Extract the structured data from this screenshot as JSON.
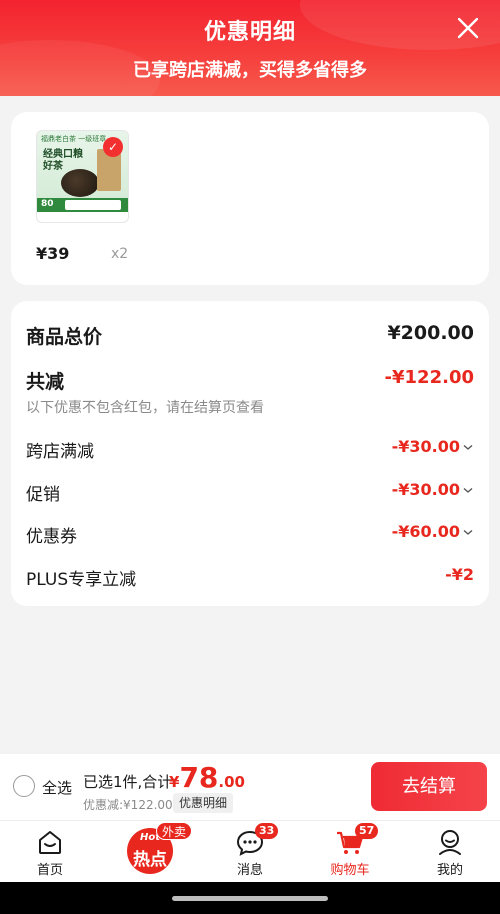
{
  "header": {
    "title": "优惠明细",
    "subtitle": "已享跨店满减，买得多省得多",
    "close_icon": "close-icon"
  },
  "product": {
    "image_brand": "福鼎老白茶 一级班章",
    "image_text": "经典口粮好茶",
    "image_price_tag": "80",
    "price": "¥39",
    "quantity": "x2"
  },
  "summary": {
    "total_label": "商品总价",
    "total_value": "¥200.00",
    "reduce_label": "共减",
    "reduce_value": "-¥122.00",
    "note": "以下优惠不包含红包，请在结算页查看",
    "items": [
      {
        "label": "跨店满减",
        "value": "-¥30.00",
        "expandable": true
      },
      {
        "label": "促销",
        "value": "-¥30.00",
        "expandable": true
      },
      {
        "label": "优惠券",
        "value": "-¥60.00",
        "expandable": true
      },
      {
        "label": "PLUS专享立减",
        "value": "-¥2",
        "expandable": false
      }
    ]
  },
  "checkout": {
    "select_all": "全选",
    "selected_text": "已选1件,合计:",
    "currency": "¥",
    "amount_int": "78",
    "amount_dec": ".00",
    "discount_text": "优惠减:¥122.00",
    "detail_button": "优惠明细",
    "pay_button": "去结算"
  },
  "tabbar": {
    "tabs": [
      {
        "label": "首页",
        "icon": "home-icon"
      },
      {
        "label": "",
        "icon": "hot-icon"
      },
      {
        "label": "消息",
        "icon": "message-icon",
        "badge": "33"
      },
      {
        "label": "购物车",
        "icon": "cart-icon",
        "badge": "57",
        "active": true
      },
      {
        "label": "我的",
        "icon": "profile-icon"
      }
    ],
    "hot_top": "Hot",
    "hot_main": "热点",
    "hot_badge": "外卖"
  },
  "colors": {
    "accent": "#e8281e",
    "header_bg": "#f3232f",
    "page_bg": "#f3f3f3"
  }
}
